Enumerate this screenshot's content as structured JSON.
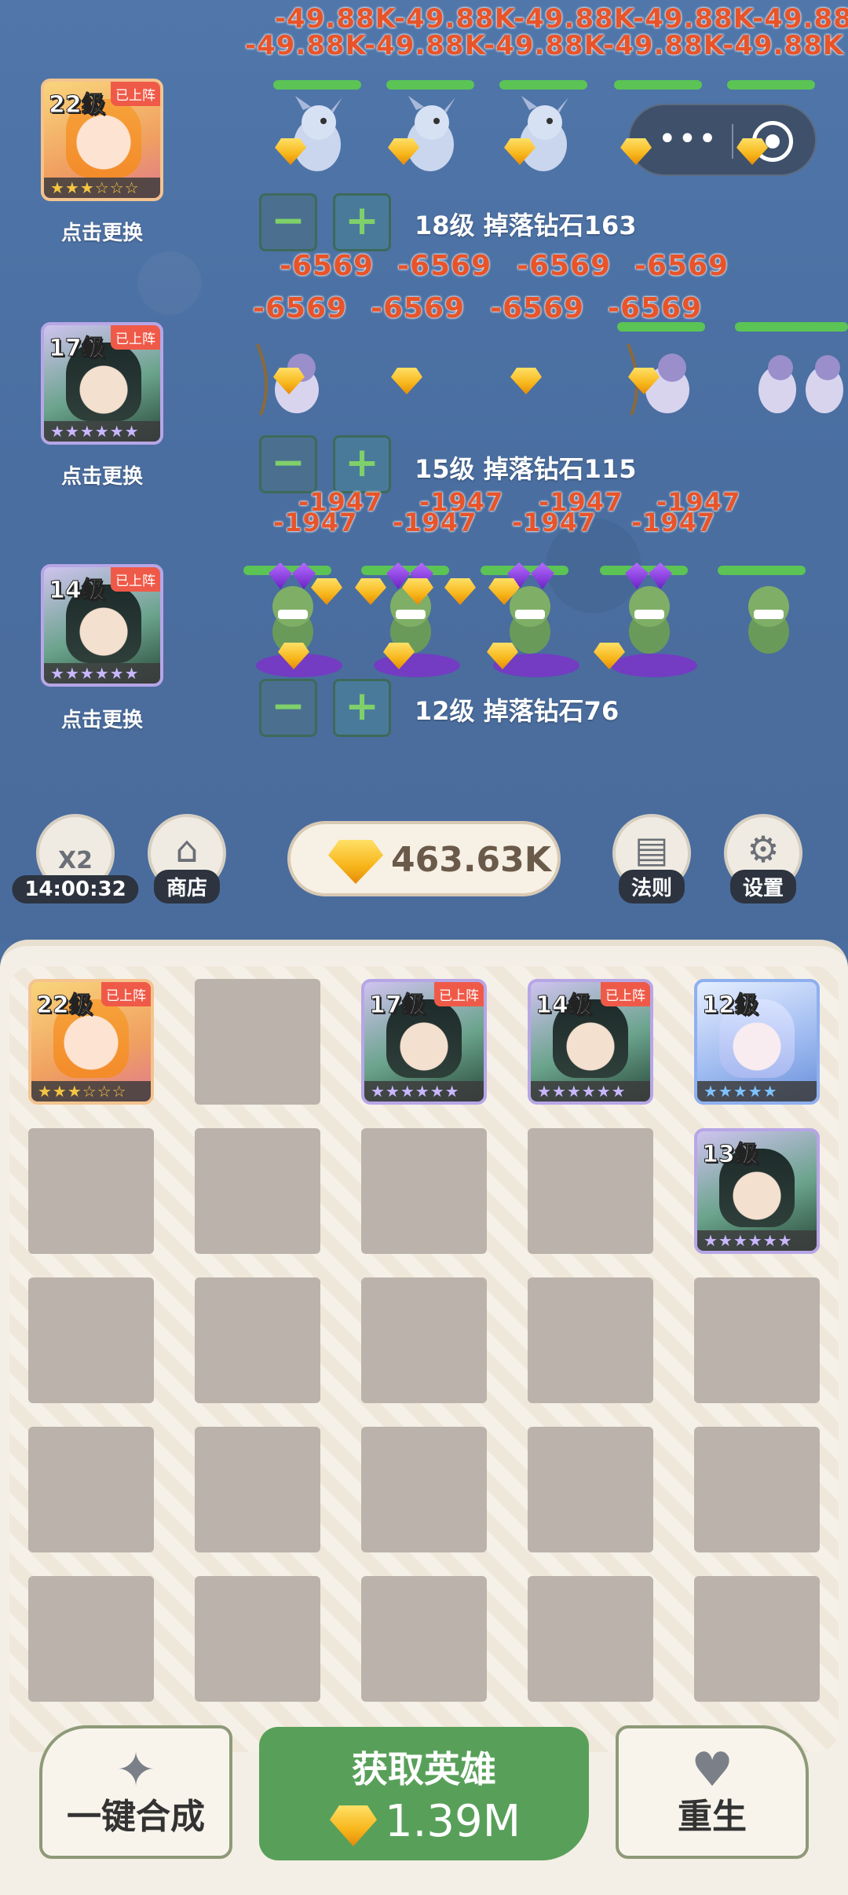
{
  "battle": {
    "top_damage": [
      "-49.88K-49.88K-49.88K-49.88K-49.88",
      "-49.88K-49.88K-49.88K-49.88K-49.88K"
    ],
    "lane1": {
      "hero_level": "22级",
      "deployed": "已上阵",
      "stars": "★★★☆☆☆",
      "change_label": "点击更换",
      "minus": "−",
      "plus": "+",
      "info": "18级 掉落钻石163",
      "damage": [
        "-6569",
        "-6569",
        "-6569",
        "-6569"
      ]
    },
    "lane2": {
      "hero_level": "17级",
      "deployed": "已上阵",
      "stars": "★★★★★★",
      "change_label": "点击更换",
      "minus": "−",
      "plus": "+",
      "info": "15级 掉落钻石115",
      "damage": [
        "-6569",
        "-6569",
        "-6569",
        "-6569"
      ],
      "damage_low": [
        "-1947",
        "-1947",
        "-1947",
        "-1947"
      ],
      "damage_low2": [
        "-1947",
        "-1947",
        "-1947",
        "-1947"
      ]
    },
    "lane3": {
      "hero_level": "14级",
      "deployed": "已上阵",
      "stars": "★★★★★★",
      "change_label": "点击更换",
      "minus": "−",
      "plus": "+",
      "info": "12级 掉落钻石76"
    }
  },
  "toolbar": {
    "x2_label": "X2",
    "x2_timer": "14:00:32",
    "shop_label": "商店",
    "gem_total": "463.63K",
    "rules_label": "法则",
    "settings_label": "设置"
  },
  "inventory": {
    "slots": [
      {
        "level": "22级",
        "deployed": "已上阵",
        "stars": "★★★☆☆☆",
        "rarity": "orange"
      },
      {
        "level": "",
        "deployed": "",
        "stars": "",
        "rarity": "empty"
      },
      {
        "level": "17级",
        "deployed": "已上阵",
        "stars": "★★★★★★",
        "rarity": "purple"
      },
      {
        "level": "14级",
        "deployed": "已上阵",
        "stars": "★★★★★★",
        "rarity": "purple"
      },
      {
        "level": "12级",
        "deployed": "",
        "stars": "★★★★★",
        "rarity": "blue"
      },
      {
        "level": "13级",
        "deployed": "",
        "stars": "★★★★★★",
        "rarity": "purple"
      }
    ]
  },
  "actions": {
    "merge_label": "一键合成",
    "get_hero_label": "获取英雄",
    "get_hero_cost": "1.39M",
    "rebirth_label": "重生"
  },
  "colors": {
    "battle_bg": "#4a6ea0",
    "damage": "#e8542a",
    "hp": "#5bc455",
    "primary_button": "#58a05a"
  }
}
